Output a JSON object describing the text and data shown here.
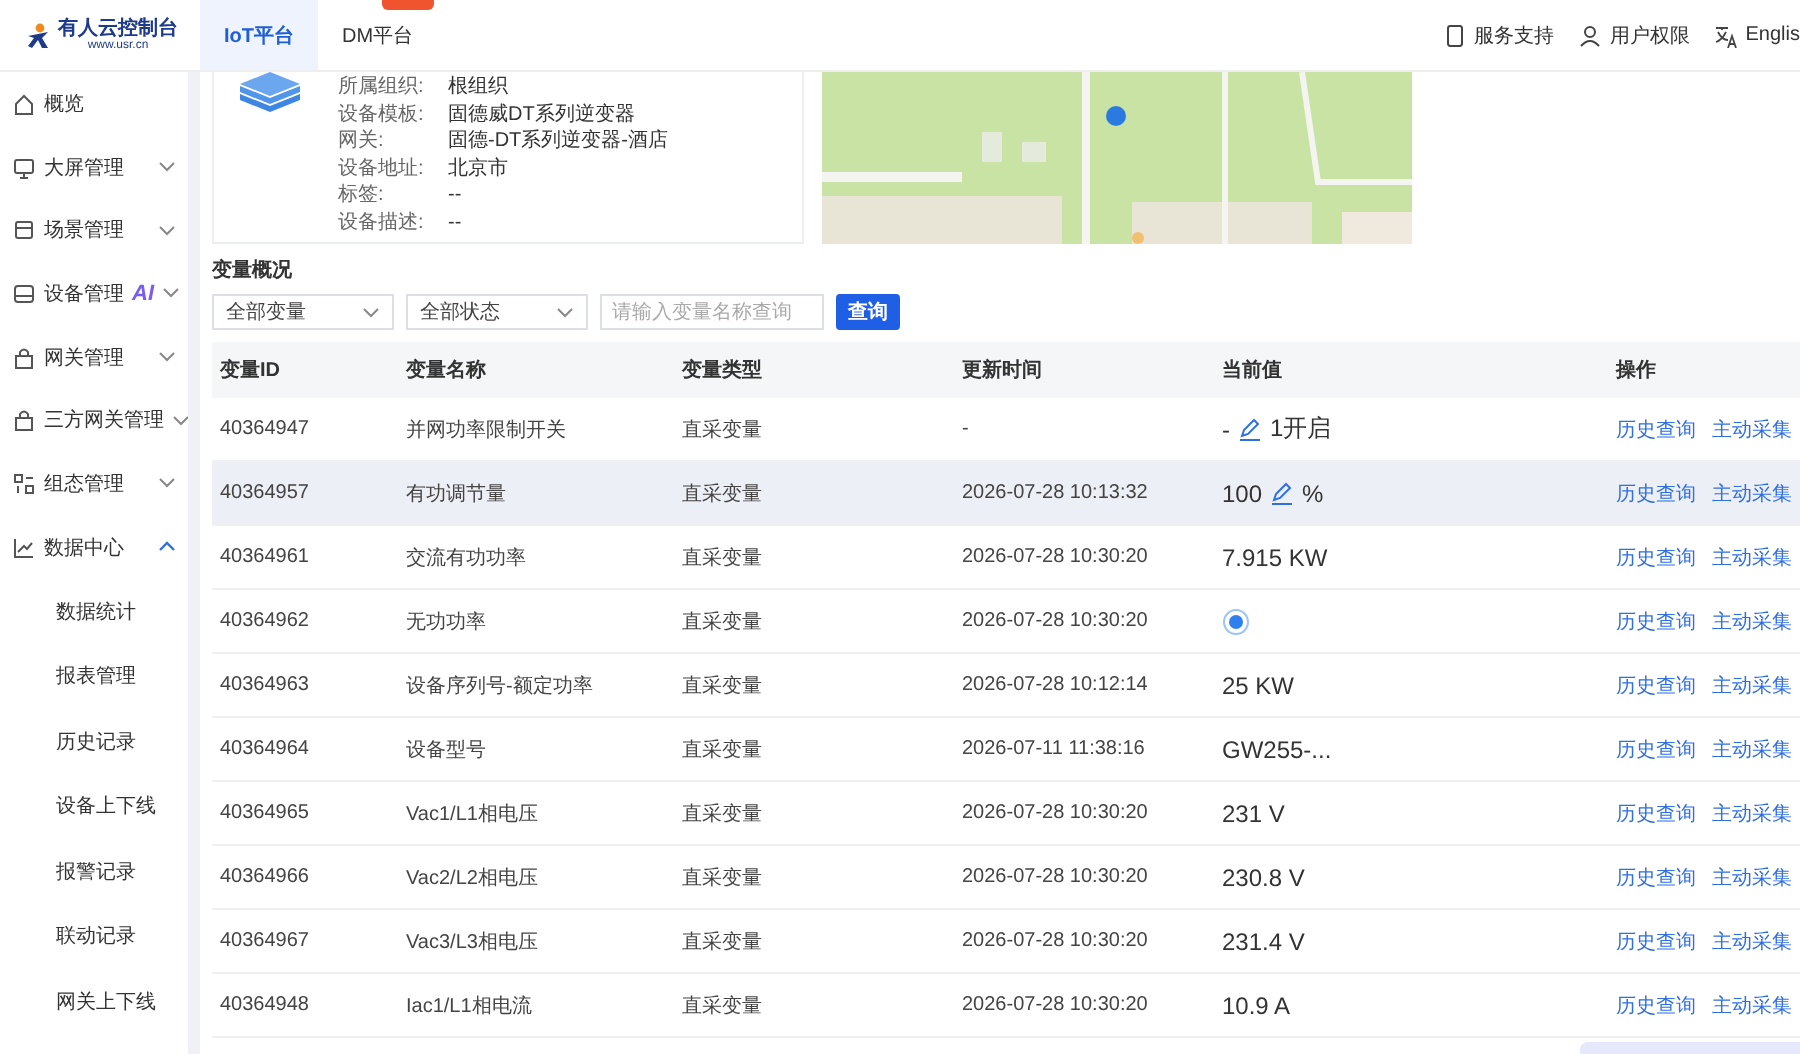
{
  "header": {
    "logo_title": "有人云控制台",
    "logo_url": "www.usr.cn",
    "tabs": [
      {
        "label": "IoT平台",
        "selected": true,
        "badge": false
      },
      {
        "label": "DM平台",
        "selected": false,
        "badge": true
      }
    ],
    "links": [
      {
        "label": "服务支持"
      },
      {
        "label": "用户权限"
      },
      {
        "label": "Englis"
      }
    ]
  },
  "sidebar": {
    "items": [
      {
        "label": "概览"
      },
      {
        "label": "大屏管理",
        "expanded": false
      },
      {
        "label": "场景管理",
        "expanded": false
      },
      {
        "label": "设备管理",
        "badge": "AI",
        "expanded": false
      },
      {
        "label": "网关管理",
        "expanded": false
      },
      {
        "label": "三方网关管理",
        "expanded": false
      },
      {
        "label": "组态管理",
        "expanded": false
      },
      {
        "label": "数据中心",
        "expanded": true,
        "children": [
          {
            "label": "数据统计"
          },
          {
            "label": "报表管理"
          },
          {
            "label": "历史记录"
          },
          {
            "label": "设备上下线"
          },
          {
            "label": "报警记录"
          },
          {
            "label": "联动记录"
          },
          {
            "label": "网关上下线"
          }
        ]
      }
    ]
  },
  "device_info": {
    "fields": [
      {
        "label": "所属组织:",
        "value": "根组织"
      },
      {
        "label": "设备模板:",
        "value": "固德威DT系列逆变器"
      },
      {
        "label": "网关:",
        "value": "固德-DT系列逆变器-酒店"
      },
      {
        "label": "设备地址:",
        "value": "北京市"
      },
      {
        "label": "标签:",
        "value": "--"
      },
      {
        "label": "设备描述:",
        "value": "--"
      }
    ]
  },
  "variables": {
    "title": "变量概况",
    "filters": [
      {
        "kind": "select",
        "value": "全部变量"
      },
      {
        "kind": "select",
        "value": "全部状态"
      },
      {
        "kind": "input",
        "placeholder": "请输入变量名称查询"
      }
    ],
    "search_button": "查询",
    "table": {
      "columns": [
        "变量ID",
        "变量名称",
        "变量类型",
        "更新时间",
        "当前值",
        "操作"
      ],
      "rows": [
        {
          "id": "40364947",
          "name": "并网功率限制开关",
          "type": "直采变量",
          "time": "-",
          "highlighted": false,
          "value": {
            "kind": "editable",
            "prefix": "-",
            "suffix": "1开启"
          },
          "actions": [
            "历史查询",
            "主动采集"
          ]
        },
        {
          "id": "40364957",
          "name": "有功调节量",
          "type": "直采变量",
          "time": "2026-07-28 10:13:32",
          "highlighted": true,
          "value": {
            "kind": "editable",
            "prefix": "100",
            "suffix": "%"
          },
          "actions": [
            "历史查询",
            "主动采集"
          ]
        },
        {
          "id": "40364961",
          "name": "交流有功功率",
          "type": "直采变量",
          "time": "2026-07-28 10:30:20",
          "highlighted": false,
          "value": {
            "kind": "text",
            "text": "7.915 KW"
          },
          "actions": [
            "历史查询",
            "主动采集"
          ]
        },
        {
          "id": "40364962",
          "name": "无功功率",
          "type": "直采变量",
          "time": "2026-07-28 10:30:20",
          "highlighted": false,
          "value": {
            "kind": "indicator"
          },
          "actions": [
            "历史查询",
            "主动采集"
          ]
        },
        {
          "id": "40364963",
          "name": "设备序列号-额定功率",
          "type": "直采变量",
          "time": "2026-07-28 10:12:14",
          "highlighted": false,
          "value": {
            "kind": "text",
            "text": "25 KW"
          },
          "actions": [
            "历史查询",
            "主动采集"
          ]
        },
        {
          "id": "40364964",
          "name": "设备型号",
          "type": "直采变量",
          "time": "2026-07-11 11:38:16",
          "highlighted": false,
          "value": {
            "kind": "text",
            "text": "GW255-..."
          },
          "actions": [
            "历史查询",
            "主动采集"
          ]
        },
        {
          "id": "40364965",
          "name": "Vac1/L1相电压",
          "type": "直采变量",
          "time": "2026-07-28 10:30:20",
          "highlighted": false,
          "value": {
            "kind": "text",
            "text": "231 V"
          },
          "actions": [
            "历史查询",
            "主动采集"
          ]
        },
        {
          "id": "40364966",
          "name": "Vac2/L2相电压",
          "type": "直采变量",
          "time": "2026-07-28 10:30:20",
          "highlighted": false,
          "value": {
            "kind": "text",
            "text": "230.8 V"
          },
          "actions": [
            "历史查询",
            "主动采集"
          ]
        },
        {
          "id": "40364967",
          "name": "Vac3/L3相电压",
          "type": "直采变量",
          "time": "2026-07-28 10:30:20",
          "highlighted": false,
          "value": {
            "kind": "text",
            "text": "231.4 V"
          },
          "actions": [
            "历史查询",
            "主动采集"
          ]
        },
        {
          "id": "40364948",
          "name": "Iac1/L1相电流",
          "type": "直采变量",
          "time": "2026-07-28 10:30:20",
          "highlighted": false,
          "value": {
            "kind": "text",
            "text": "10.9 A"
          },
          "actions": [
            "历史查询",
            "主动采集"
          ]
        }
      ]
    }
  }
}
